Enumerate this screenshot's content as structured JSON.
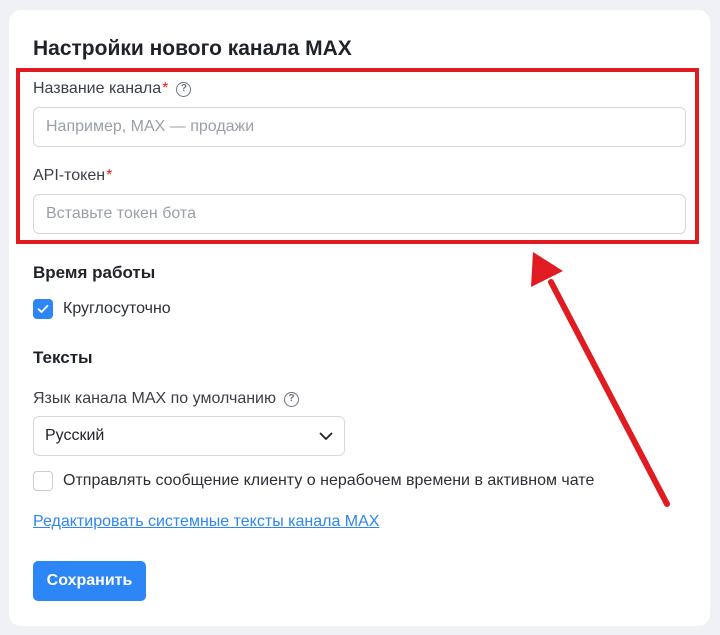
{
  "form": {
    "title": "Настройки нового канала MAX",
    "channel_name": {
      "label": "Название канала",
      "required_mark": "*",
      "help": "?",
      "placeholder": "Например, MAX — продажи",
      "value": ""
    },
    "api_token": {
      "label": "API-токен",
      "required_mark": "*",
      "placeholder": "Вставьте токен бота",
      "value": ""
    }
  },
  "work_time": {
    "title": "Время работы",
    "around_clock": {
      "label": "Круглосуточно",
      "checked": true
    }
  },
  "texts": {
    "title": "Тексты",
    "language_label": "Язык канала MAX по умолчанию",
    "language_help": "?",
    "language_selected": "Русский",
    "off_hours": {
      "label": "Отправлять сообщение клиенту о нерабочем времени в активном чате",
      "checked": false
    },
    "edit_link": "Редактировать системные тексты канала MAX"
  },
  "actions": {
    "save_label": "Сохранить"
  },
  "colors": {
    "accent": "#2d86f5",
    "annotation": "#e01b22",
    "required": "#e02020"
  },
  "icons": {
    "help": "question-circle-icon",
    "check": "checkmark-icon",
    "dropdown": "chevron-down-icon",
    "annotation": "red-arrow-icon"
  }
}
